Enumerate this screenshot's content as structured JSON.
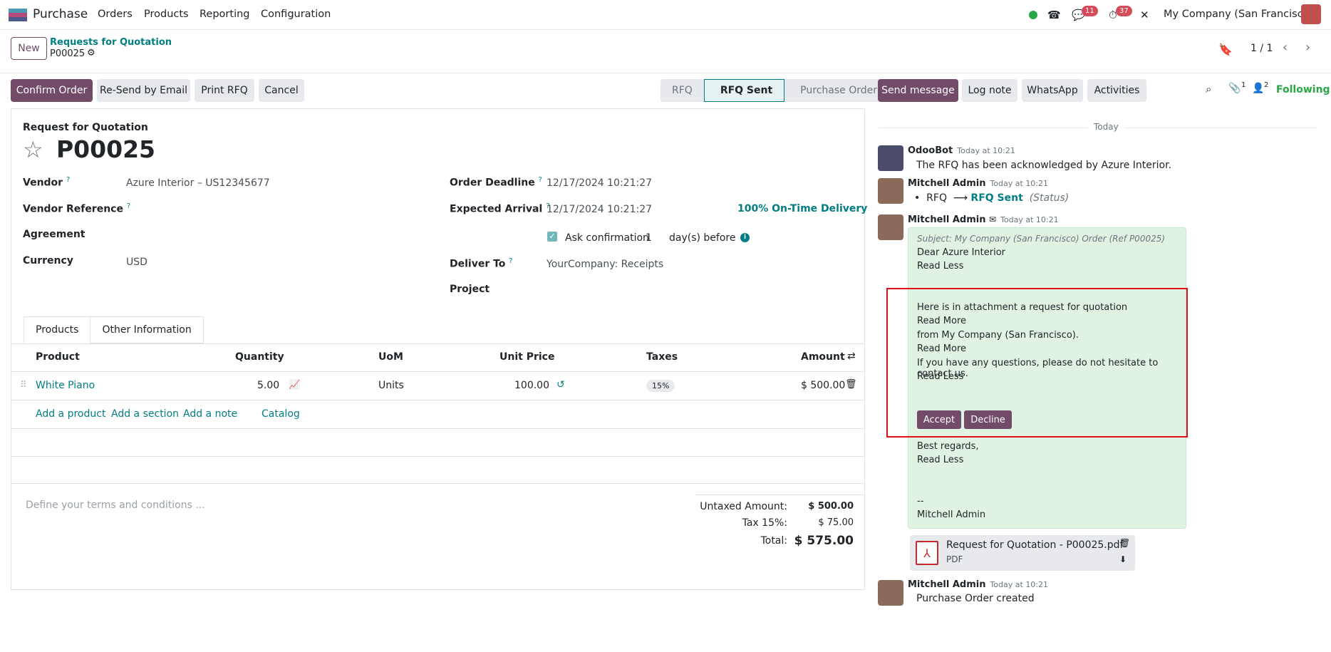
{
  "topnav": {
    "app_name": "Purchase",
    "menu": [
      "Orders",
      "Products",
      "Reporting",
      "Configuration"
    ],
    "messages_count": "11",
    "activities_count": "37",
    "company": "My Company (San Francisco)"
  },
  "control": {
    "new_label": "New",
    "breadcrumb_parent": "Requests for Quotation",
    "breadcrumb_current": "P00025",
    "pager": "1 / 1"
  },
  "actions": {
    "confirm": "Confirm Order",
    "resend": "Re-Send by Email",
    "print": "Print RFQ",
    "cancel": "Cancel"
  },
  "status": {
    "stages": [
      "RFQ",
      "RFQ Sent",
      "Purchase Order"
    ],
    "active": "RFQ Sent"
  },
  "form": {
    "doc_type": "Request for Quotation",
    "name": "P00025",
    "vendor_label": "Vendor",
    "vendor_value": "Azure Interior – US12345677",
    "vendor_ref_label": "Vendor Reference",
    "agreement_label": "Agreement",
    "currency_label": "Currency",
    "currency_value": "USD",
    "order_deadline_label": "Order Deadline",
    "order_deadline_value": "12/17/2024 10:21:27",
    "expected_arrival_label": "Expected Arrival",
    "expected_arrival_value": "12/17/2024 10:21:27",
    "on_time_delivery": "100% On-Time Delivery",
    "ask_confirmation_label": "Ask confirmation",
    "ask_confirmation_days": "1",
    "days_before": "day(s) before",
    "deliver_to_label": "Deliver To",
    "deliver_to_value": "YourCompany: Receipts",
    "project_label": "Project",
    "help_mark": "?"
  },
  "tabs": [
    "Products",
    "Other Information"
  ],
  "table": {
    "headers": {
      "product": "Product",
      "quantity": "Quantity",
      "uom": "UoM",
      "unit_price": "Unit Price",
      "taxes": "Taxes",
      "amount": "Amount"
    },
    "rows": [
      {
        "product": "White Piano",
        "quantity": "5.00",
        "uom": "Units",
        "unit_price": "100.00",
        "taxes": "15%",
        "amount": "$ 500.00"
      }
    ],
    "add_links": [
      "Add a product",
      "Add a section",
      "Add a note",
      "Catalog"
    ]
  },
  "terms_placeholder": "Define your terms and conditions ...",
  "totals": {
    "untaxed_label": "Untaxed Amount:",
    "untaxed_value": "$ 500.00",
    "tax_label": "Tax 15%:",
    "tax_value": "$ 75.00",
    "total_label": "Total:",
    "total_value": "$ 575.00"
  },
  "chatter": {
    "send_message": "Send message",
    "log_note": "Log note",
    "whatsapp": "WhatsApp",
    "activities": "Activities",
    "attachments_count": "1",
    "followers_count": "2",
    "following": "Following",
    "day_label": "Today",
    "messages": [
      {
        "author": "OdooBot",
        "time": "Today at 10:21",
        "body": "The RFQ has been acknowledged by Azure Interior."
      },
      {
        "author": "Mitchell Admin",
        "time": "Today at 10:21",
        "tracking_old": "RFQ",
        "tracking_arrow": "⟶",
        "tracking_new": "RFQ Sent",
        "tracking_field": "(Status)"
      },
      {
        "author": "Mitchell Admin",
        "time": "Today at 10:21",
        "subject": "Subject: My Company (San Francisco) Order (Ref P00025)",
        "greeting": "Dear Azure Interior",
        "read_less_1": "Read Less",
        "line1": "Here is in attachment a request for quotation",
        "read_more_1": "Read More",
        "line2": "from My Company (San Francisco).",
        "read_more_2": "Read More",
        "line3": "If you have any questions, please do not hesitate to contact us.",
        "read_less_2": "Read Less",
        "accept": "Accept",
        "decline": "Decline",
        "regards": "Best regards,",
        "read_less_3": "Read Less",
        "sig_sep": "--",
        "signature": "Mitchell Admin"
      },
      {
        "author": "Mitchell Admin",
        "time": "Today at 10:21",
        "body": "Purchase Order created"
      }
    ],
    "attachment": {
      "name": "Request for Quotation - P00025.pdf",
      "type": "PDF"
    }
  }
}
